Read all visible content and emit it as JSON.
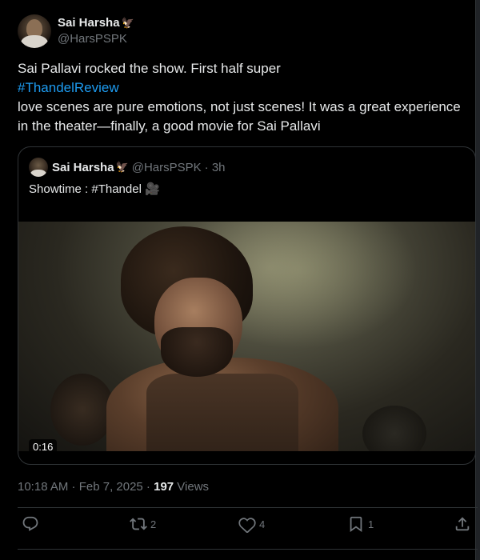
{
  "author": {
    "display_name": "Sai Harsha",
    "handle": "@HarsPSPK",
    "badge": "🦅"
  },
  "tweet": {
    "line1": "Sai Pallavi rocked the show. First half super",
    "hashtag": "#ThandelReview",
    "line3": "love scenes are pure emotions, not just scenes! It was a great experience",
    "line4": "in the theater—finally, a good movie for Sai Pallavi"
  },
  "quoted": {
    "display_name": "Sai Harsha",
    "badge": "🦅",
    "handle": "@HarsPSPK",
    "time": "· 3h",
    "text": "Showtime : #Thandel 🎥",
    "video_duration": "0:16"
  },
  "meta": {
    "timestamp": "10:18 AM · Feb 7, 2025 · ",
    "views_count": "197",
    "views_label": " Views"
  },
  "actions": {
    "reply_count": "",
    "retweet_count": "2",
    "like_count": "4",
    "bookmark_count": "1"
  },
  "colors": {
    "background": "#000000",
    "text": "#e7e9ea",
    "secondary": "#71767b",
    "link": "#1d9bf0",
    "border": "#2f3336"
  }
}
